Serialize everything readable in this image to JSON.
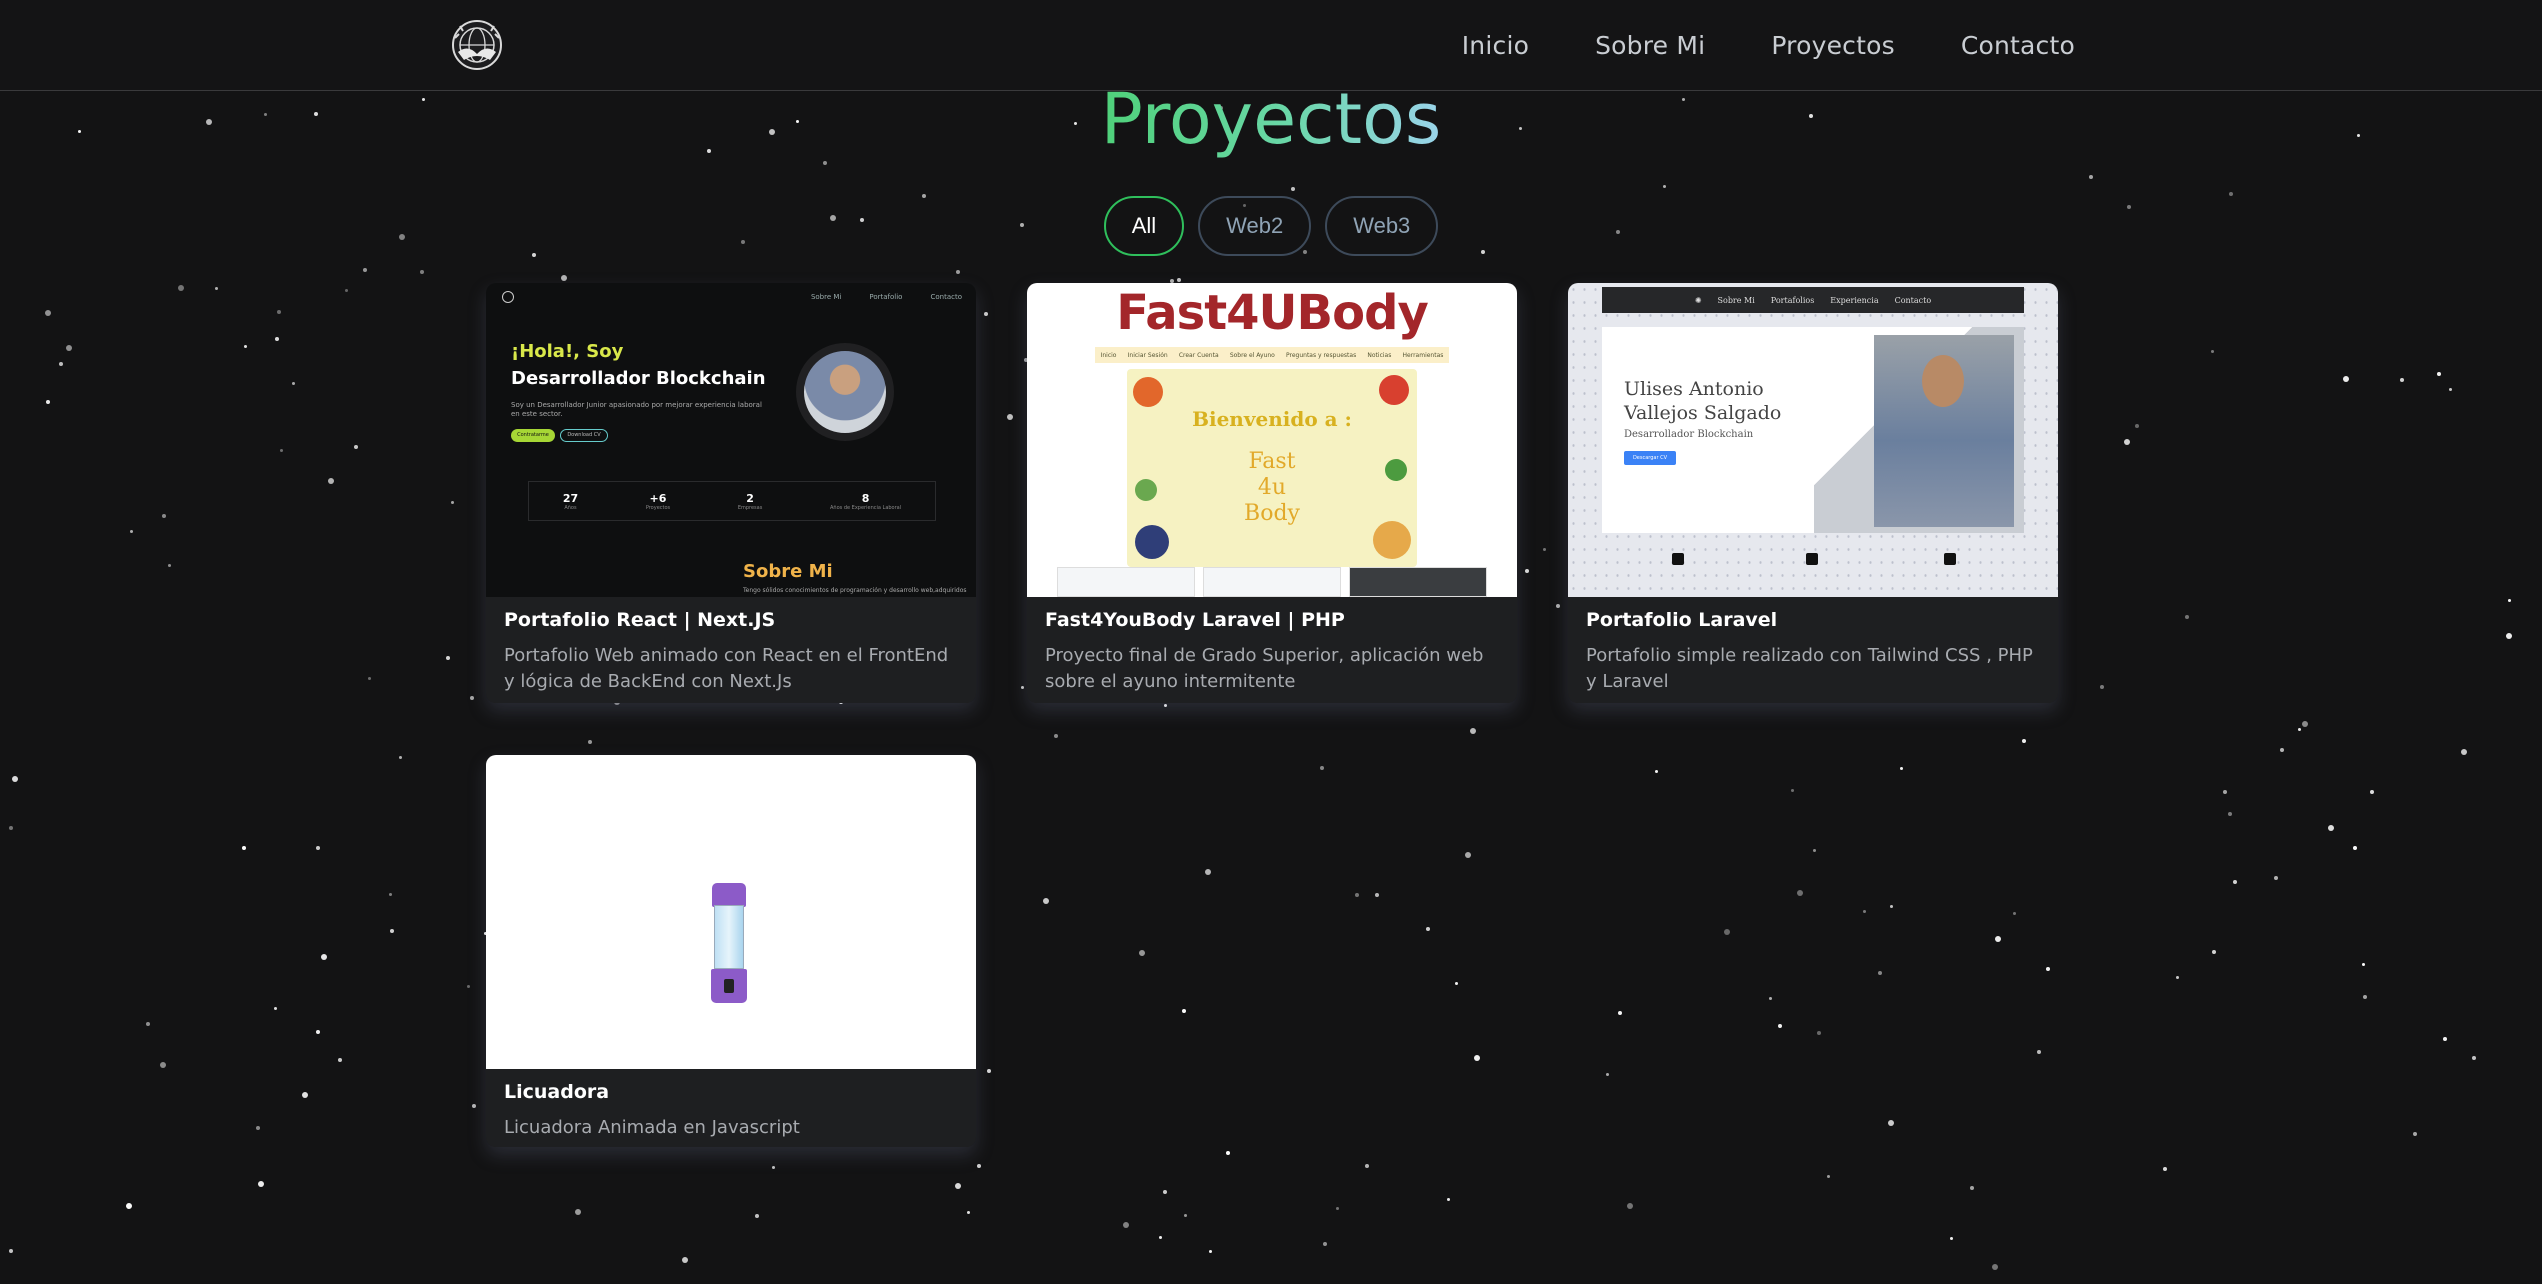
{
  "nav": {
    "logo_icon": "globe-hands-logo",
    "links": [
      "Inicio",
      "Sobre Mi",
      "Proyectos",
      "Contacto"
    ]
  },
  "section": {
    "title": "Proyectos",
    "filters": [
      {
        "label": "All",
        "active": true
      },
      {
        "label": "Web2",
        "active": false
      },
      {
        "label": "Web3",
        "active": false
      }
    ]
  },
  "colors": {
    "background": "#131314",
    "accent_green": "#4fd17a",
    "filter_border": "#3d4a5a",
    "active_border": "#2fbf5c"
  },
  "projects": [
    {
      "title": "Portafolio React | Next.JS",
      "description": "Portafolio Web animado con React en el FrontEnd y lógica de BackEnd con Next.Js",
      "preview": {
        "nav": [
          "Sobre Mi",
          "Portafolio",
          "Contacto"
        ],
        "greeting": "¡Hola!, Soy",
        "headline": "Desarrollador Blockchain",
        "intro": "Soy un Desarrollador Junior apasionado por mejorar experiencia laboral en este sector.",
        "button_primary": "Contratarme",
        "button_secondary": "Download CV",
        "stats": [
          {
            "value": "27",
            "label": "Años"
          },
          {
            "value": "+6",
            "label": "Proyectos"
          },
          {
            "value": "2",
            "label": "Empresas"
          },
          {
            "value": "8",
            "label": "Años de Experiencia Laboral"
          }
        ],
        "about_title": "Sobre Mi",
        "about_text": "Tengo sólidos conocimientos de programación y desarrollo web,adquiridos"
      }
    },
    {
      "title": "Fast4YouBody Laravel | PHP",
      "description": "Proyecto final de Grado Superior, aplicación web sobre el ayuno intermitente",
      "preview": {
        "brand": "Fast4UBody",
        "menu": [
          "Inicio",
          "Iniciar Sesión",
          "Crear Cuenta",
          "Sobre el Ayuno",
          "Preguntas y respuestas",
          "Noticias",
          "Herramientas"
        ],
        "hero_line1": "Bienvenido a :",
        "hero_line2": "Fast",
        "hero_line3": "4u",
        "hero_line4": "Body"
      }
    },
    {
      "title": "Portafolio Laravel",
      "description": "Portafolio simple realizado con Tailwind CSS , PHP y Laravel",
      "preview": {
        "nav": [
          "Sobre Mi",
          "Portafolios",
          "Experiencia",
          "Contacto"
        ],
        "name_line1": "Ulises Antonio",
        "name_line2": "Vallejos Salgado",
        "role": "Desarrollador Blockchain",
        "cta": "Descargar CV",
        "social_icons": [
          "github-icon",
          "linkedin-icon",
          "twitter-icon"
        ]
      }
    },
    {
      "title": "Licuadora",
      "description": "Licuadora Animada en Javascript",
      "preview": {
        "image_icon": "blender-icon"
      }
    }
  ]
}
